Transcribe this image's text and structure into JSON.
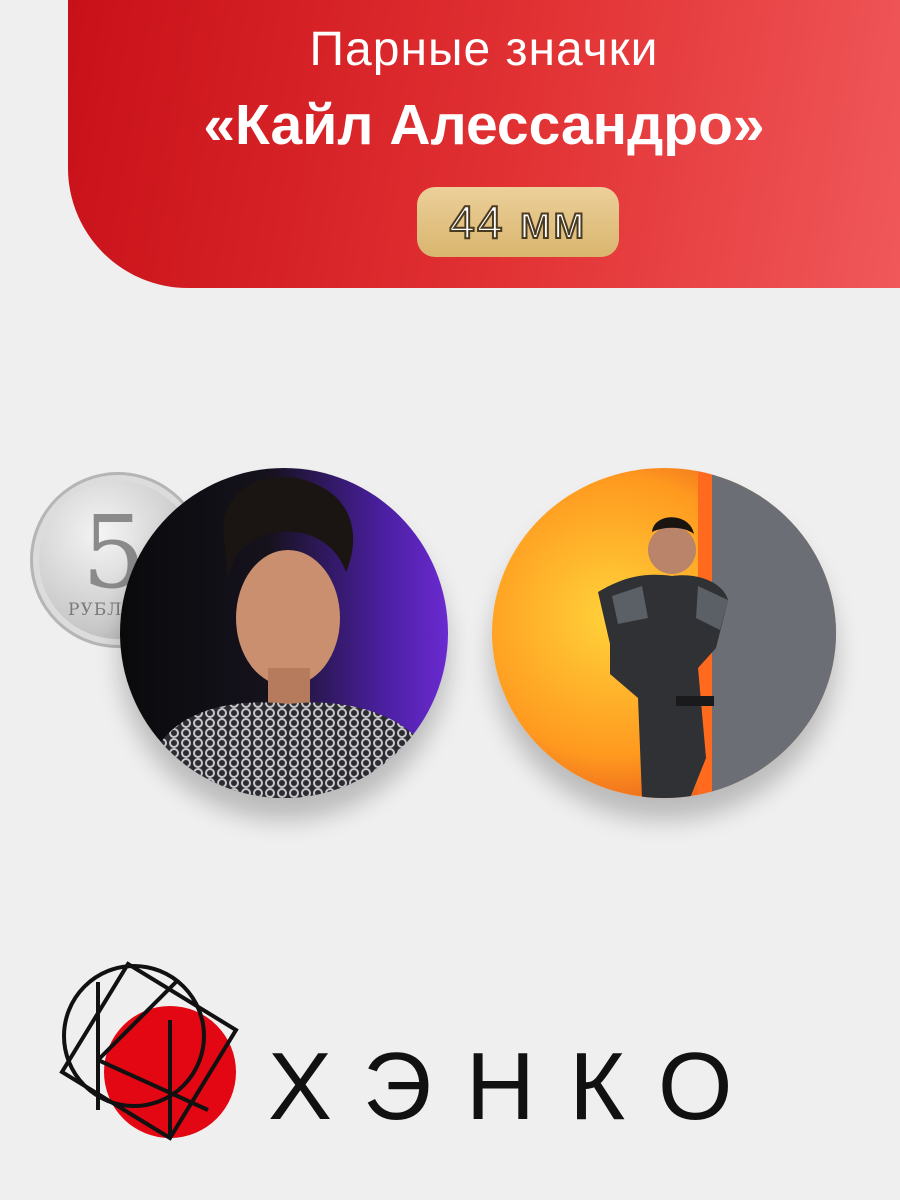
{
  "header": {
    "subtitle": "Парные значки",
    "title": "«Кайл Алессандро»",
    "size": "44 мм"
  },
  "coin": {
    "number": "5",
    "word": "РУБЛЬ"
  },
  "badges": [
    {
      "name": "portrait-badge"
    },
    {
      "name": "stage-badge"
    }
  ],
  "brand": {
    "name": "ХЭНКО"
  },
  "colors": {
    "banner_red": "#e02a2d",
    "badge_gold": "#e2c283",
    "background": "#efefef",
    "logo_red": "#e30613"
  }
}
